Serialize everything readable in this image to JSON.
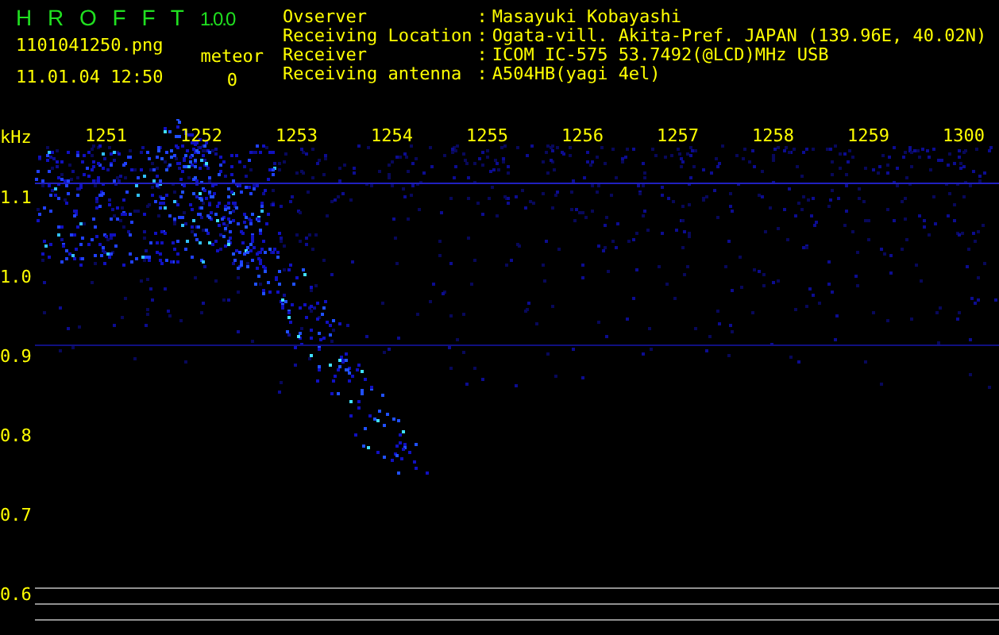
{
  "app": {
    "name": "H R O F F T",
    "version": "1.0.0"
  },
  "file": {
    "name": "1101041250.png",
    "datetime": "11.01.04 12:50"
  },
  "meteor": {
    "label": "meteor",
    "count": "0"
  },
  "info": [
    {
      "label": "Ovserver",
      "separator": ":",
      "value": "Masayuki Kobayashi"
    },
    {
      "label": "Receiving Location",
      "separator": ":",
      "value": "Ogata-vill. Akita-Pref. JAPAN (139.96E, 40.02N)"
    },
    {
      "label": "Receiver",
      "separator": ":",
      "value": "ICOM IC-575 53.7492(@LCD)MHz USB"
    },
    {
      "label": "Receiving antenna",
      "separator": ":",
      "value": "A504HB(yagi 4el)"
    }
  ],
  "spectrogram": {
    "unit": "kHz",
    "time_labels": [
      "1251",
      "1252",
      "1253",
      "1254",
      "1255",
      "1256",
      "1257",
      "1258",
      "1259",
      "1300"
    ],
    "freq_labels": [
      "1.1",
      "1.0",
      "0.9",
      "0.8",
      "0.7",
      "0.6"
    ]
  }
}
